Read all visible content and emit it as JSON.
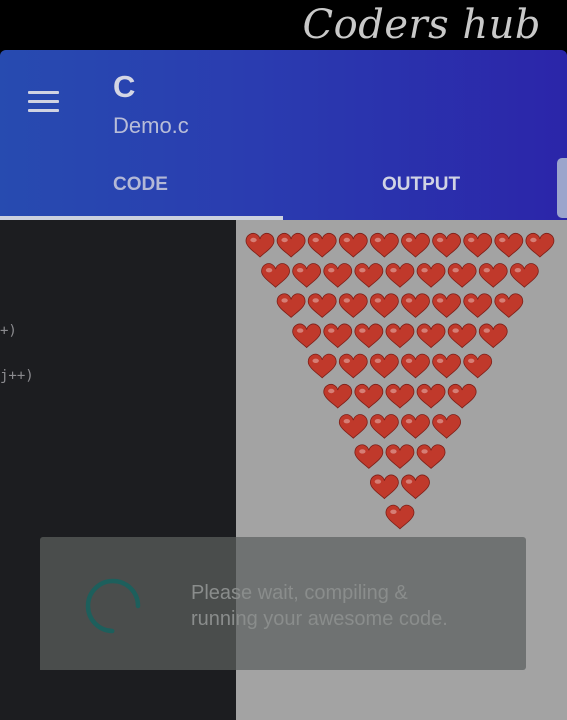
{
  "watermark": {
    "text": "Coders hub"
  },
  "appbar": {
    "title": "C",
    "subtitle": "Demo.c",
    "tabs": [
      {
        "label": "CODE",
        "selected": true
      },
      {
        "label": "OUTPUT",
        "selected": false
      }
    ]
  },
  "code": {
    "lines": [
      "+)",
      "j++)"
    ]
  },
  "output": {
    "glyph": "❤",
    "heart_color": "#c0392b",
    "row_counts": [
      10,
      9,
      8,
      7,
      6,
      5,
      4,
      3,
      2,
      1
    ]
  },
  "loading": {
    "line1": "Please wait, compiling &",
    "line2": "running your awesome code."
  },
  "colors": {
    "appbar_start": "#274bb0",
    "appbar_end": "#2b25a9",
    "code_bg": "#1c1d20",
    "output_bg": "#a3a3a3",
    "spinner": "#1d5f5c"
  }
}
